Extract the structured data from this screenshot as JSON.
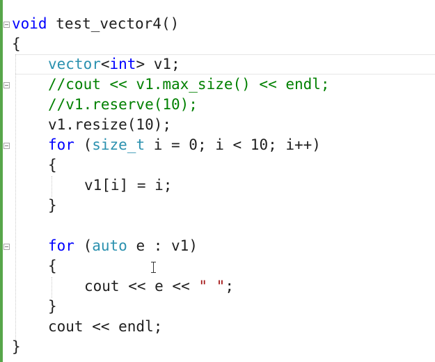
{
  "code": {
    "l1_kw": "void",
    "l1_fn": " test_vector4()",
    "l2": "{",
    "l3_ty": "vector",
    "l3_op1": "<",
    "l3_kw": "int",
    "l3_rest": "> v1;",
    "l4_cm": "//cout << v1.max_size() << endl;",
    "l5_cm": "//v1.reserve(10);",
    "l6": "v1.resize(10);",
    "l7_kw": "for",
    "l7_a": " (",
    "l7_ty": "size_t",
    "l7_rest": " i = 0; i < 10; i++)",
    "l8": "{",
    "l9": "v1[i] = i;",
    "l10": "}",
    "l12_kw": "for",
    "l12_a": " (",
    "l12_kw2": "auto",
    "l12_rest": " e : v1)",
    "l13": "{",
    "l14_a": "cout << e << ",
    "l14_st": "\" \"",
    "l14_b": ";",
    "l15": "}",
    "l16": "cout << endl;",
    "l17": "}"
  },
  "colors": {
    "keyword": "#0000ff",
    "type": "#2b91af",
    "comment": "#008000",
    "string": "#a31515",
    "change_bar": "#57a64a"
  }
}
